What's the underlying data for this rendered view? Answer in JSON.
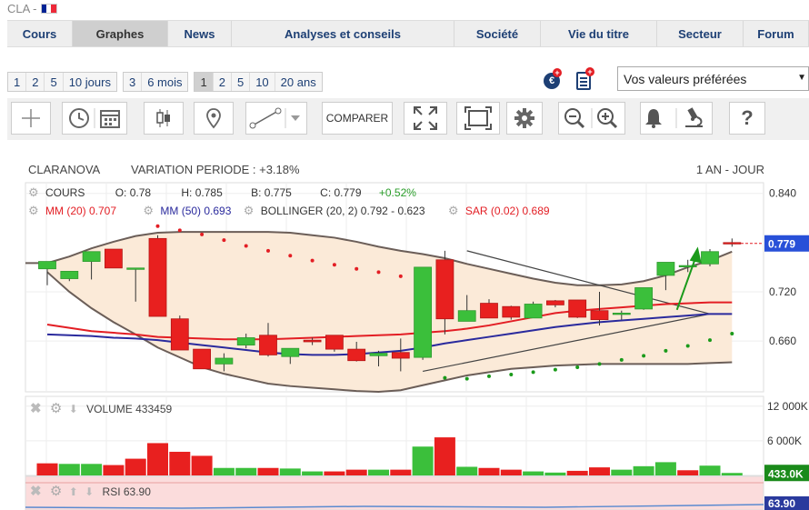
{
  "header": {
    "ticker": "CLA -",
    "flag_colors": [
      "#002395",
      "#ffffff",
      "#ed2939"
    ]
  },
  "nav": {
    "tabs": [
      {
        "label": "Cours",
        "width": 72
      },
      {
        "label": "Graphes",
        "width": 105,
        "active": true
      },
      {
        "label": "News",
        "width": 70
      },
      {
        "label": "Analyses et conseils",
        "width": 245
      },
      {
        "label": "Société",
        "width": 95
      },
      {
        "label": "Vie du titre",
        "width": 128
      },
      {
        "label": "Secteur",
        "width": 95
      },
      {
        "label": "Forum",
        "width": 72
      }
    ]
  },
  "periods": {
    "days": [
      "1",
      "2",
      "5",
      "10 jours"
    ],
    "months": [
      "3",
      "6 mois"
    ],
    "years": [
      "1",
      "2",
      "5",
      "10",
      "20 ans"
    ],
    "active_year": "1"
  },
  "favorites": {
    "label": "Vos valeurs préférées",
    "arrow": "▼"
  },
  "toolbar": {
    "compare_label": "COMPARER",
    "help_label": "?",
    "icons": [
      "crosshair-icon",
      "clock-icon",
      "calendar-icon",
      "candlestick-icon",
      "pin-icon",
      "trendline-icon",
      "dropdown-icon",
      "fullscreen-icon",
      "frame-icon",
      "gear-icon",
      "zoom-out-icon",
      "zoom-in-icon",
      "bell-icon",
      "microscope-icon",
      "help-icon"
    ]
  },
  "chart_header": {
    "name": "CLARANOVA",
    "variation": "VARIATION PERIODE : +3.18%",
    "period": "1 AN - JOUR"
  },
  "legend": {
    "cours_label": "COURS",
    "open": "O: 0.78",
    "high": "H: 0.785",
    "low": "B: 0.775",
    "close": "C: 0.779",
    "change": "+0.52%",
    "mm20": "MM (20) 0.707",
    "mm50": "MM (50) 0.693",
    "bollinger": "BOLLINGER (20, 2) 0.792 - 0.623",
    "sar": "SAR (0.02) 0.689",
    "volume": "VOLUME  433459",
    "rsi": "RSI  63.90"
  },
  "chart_data": {
    "type": "candlestick",
    "y_axis": {
      "ticks": [
        "0.840",
        "0.720",
        "0.660"
      ],
      "tick_values": [
        0.84,
        0.72,
        0.66
      ],
      "min": 0.598,
      "max": 0.853
    },
    "last_price": "0.779",
    "last_price_value": 0.779,
    "volume_axis": {
      "ticks": [
        "12 000K",
        "6 000K",
        "0.00K"
      ],
      "tick_values": [
        12000,
        6000,
        0
      ],
      "max": 13700,
      "last_label": "433.0K",
      "last_value": 433
    },
    "rsi_axis": {
      "last_label": "63.90",
      "last_value": 63.9
    },
    "candles": [
      {
        "o": 0.748,
        "h": 0.757,
        "l": 0.728,
        "c": 0.757
      },
      {
        "o": 0.736,
        "h": 0.744,
        "l": 0.733,
        "c": 0.745
      },
      {
        "o": 0.757,
        "h": 0.769,
        "l": 0.735,
        "c": 0.769
      },
      {
        "o": 0.772,
        "h": 0.772,
        "l": 0.749,
        "c": 0.749
      },
      {
        "o": 0.749,
        "h": 0.749,
        "l": 0.708,
        "c": 0.749
      },
      {
        "o": 0.785,
        "h": 0.789,
        "l": 0.69,
        "c": 0.69
      },
      {
        "o": 0.687,
        "h": 0.691,
        "l": 0.649,
        "c": 0.649
      },
      {
        "o": 0.65,
        "h": 0.65,
        "l": 0.626,
        "c": 0.626
      },
      {
        "o": 0.632,
        "h": 0.645,
        "l": 0.623,
        "c": 0.639
      },
      {
        "o": 0.655,
        "h": 0.669,
        "l": 0.651,
        "c": 0.664
      },
      {
        "o": 0.667,
        "h": 0.682,
        "l": 0.641,
        "c": 0.643
      },
      {
        "o": 0.641,
        "h": 0.65,
        "l": 0.632,
        "c": 0.651
      },
      {
        "o": 0.661,
        "h": 0.664,
        "l": 0.655,
        "c": 0.659
      },
      {
        "o": 0.667,
        "h": 0.667,
        "l": 0.647,
        "c": 0.65
      },
      {
        "o": 0.65,
        "h": 0.659,
        "l": 0.635,
        "c": 0.636
      },
      {
        "o": 0.642,
        "h": 0.648,
        "l": 0.629,
        "c": 0.645
      },
      {
        "o": 0.646,
        "h": 0.663,
        "l": 0.623,
        "c": 0.639
      },
      {
        "o": 0.64,
        "h": 0.736,
        "l": 0.637,
        "c": 0.75
      },
      {
        "o": 0.759,
        "h": 0.77,
        "l": 0.668,
        "c": 0.687
      },
      {
        "o": 0.684,
        "h": 0.716,
        "l": 0.685,
        "c": 0.697
      },
      {
        "o": 0.706,
        "h": 0.711,
        "l": 0.69,
        "c": 0.688
      },
      {
        "o": 0.702,
        "h": 0.703,
        "l": 0.686,
        "c": 0.689
      },
      {
        "o": 0.688,
        "h": 0.708,
        "l": 0.69,
        "c": 0.705
      },
      {
        "o": 0.709,
        "h": 0.71,
        "l": 0.701,
        "c": 0.704
      },
      {
        "o": 0.71,
        "h": 0.71,
        "l": 0.688,
        "c": 0.689
      },
      {
        "o": 0.697,
        "h": 0.72,
        "l": 0.679,
        "c": 0.686
      },
      {
        "o": 0.694,
        "h": 0.697,
        "l": 0.686,
        "c": 0.694
      },
      {
        "o": 0.699,
        "h": 0.714,
        "l": 0.698,
        "c": 0.725
      },
      {
        "o": 0.74,
        "h": 0.74,
        "l": 0.722,
        "c": 0.756
      },
      {
        "o": 0.752,
        "h": 0.759,
        "l": 0.744,
        "c": 0.752
      },
      {
        "o": 0.754,
        "h": 0.772,
        "l": 0.751,
        "c": 0.769
      },
      {
        "o": 0.78,
        "h": 0.785,
        "l": 0.775,
        "c": 0.779
      }
    ],
    "volume": [
      {
        "v": 2100,
        "up": false
      },
      {
        "v": 2000,
        "up": true
      },
      {
        "v": 2000,
        "up": true
      },
      {
        "v": 1800,
        "up": false
      },
      {
        "v": 2900,
        "up": false
      },
      {
        "v": 5600,
        "up": false
      },
      {
        "v": 4100,
        "up": false
      },
      {
        "v": 3400,
        "up": false
      },
      {
        "v": 1300,
        "up": true
      },
      {
        "v": 1300,
        "up": true
      },
      {
        "v": 1300,
        "up": false
      },
      {
        "v": 1200,
        "up": true
      },
      {
        "v": 700,
        "up": true
      },
      {
        "v": 700,
        "up": false
      },
      {
        "v": 1000,
        "up": false
      },
      {
        "v": 1000,
        "up": true
      },
      {
        "v": 1000,
        "up": false
      },
      {
        "v": 5000,
        "up": true
      },
      {
        "v": 6600,
        "up": false
      },
      {
        "v": 1500,
        "up": true
      },
      {
        "v": 1300,
        "up": false
      },
      {
        "v": 1000,
        "up": false
      },
      {
        "v": 700,
        "up": true
      },
      {
        "v": 500,
        "up": true
      },
      {
        "v": 800,
        "up": false
      },
      {
        "v": 1400,
        "up": false
      },
      {
        "v": 1000,
        "up": true
      },
      {
        "v": 1600,
        "up": true
      },
      {
        "v": 2300,
        "up": true
      },
      {
        "v": 900,
        "up": false
      },
      {
        "v": 1700,
        "up": true
      },
      {
        "v": 433,
        "up": true
      }
    ],
    "mm20": [
      0.68,
      0.676,
      0.672,
      0.67,
      0.668,
      0.665,
      0.664,
      0.663,
      0.662,
      0.662,
      0.662,
      0.663,
      0.664,
      0.665,
      0.666,
      0.667,
      0.668,
      0.67,
      0.672,
      0.675,
      0.679,
      0.684,
      0.689,
      0.694,
      0.697,
      0.699,
      0.701,
      0.703,
      0.705,
      0.706,
      0.707,
      0.707
    ],
    "mm50": [
      0.668,
      0.667,
      0.666,
      0.664,
      0.663,
      0.661,
      0.658,
      0.655,
      0.652,
      0.649,
      0.646,
      0.644,
      0.643,
      0.643,
      0.644,
      0.646,
      0.648,
      0.652,
      0.657,
      0.661,
      0.665,
      0.669,
      0.673,
      0.677,
      0.68,
      0.683,
      0.685,
      0.687,
      0.689,
      0.691,
      0.693,
      0.693
    ],
    "boll_upper": [
      0.755,
      0.763,
      0.773,
      0.781,
      0.788,
      0.792,
      0.793,
      0.793,
      0.793,
      0.793,
      0.793,
      0.792,
      0.789,
      0.786,
      0.781,
      0.775,
      0.77,
      0.766,
      0.761,
      0.754,
      0.748,
      0.742,
      0.736,
      0.731,
      0.728,
      0.728,
      0.729,
      0.733,
      0.74,
      0.75,
      0.758,
      0.769
    ],
    "boll_lower": [
      0.744,
      0.72,
      0.7,
      0.683,
      0.668,
      0.652,
      0.64,
      0.628,
      0.62,
      0.614,
      0.608,
      0.605,
      0.603,
      0.601,
      0.599,
      0.598,
      0.6,
      0.606,
      0.612,
      0.618,
      0.622,
      0.626,
      0.628,
      0.63,
      0.631,
      0.632,
      0.632,
      0.632,
      0.632,
      0.632,
      0.633,
      0.634
    ],
    "sar": [
      null,
      null,
      null,
      null,
      null,
      0.8,
      0.795,
      0.79,
      0.783,
      0.776,
      0.77,
      0.764,
      0.758,
      0.753,
      0.748,
      0.744,
      0.739,
      null,
      0.615,
      0.614,
      0.617,
      0.619,
      0.622,
      0.625,
      0.628,
      0.632,
      0.637,
      0.642,
      0.648,
      0.654,
      0.661,
      0.669
    ]
  }
}
